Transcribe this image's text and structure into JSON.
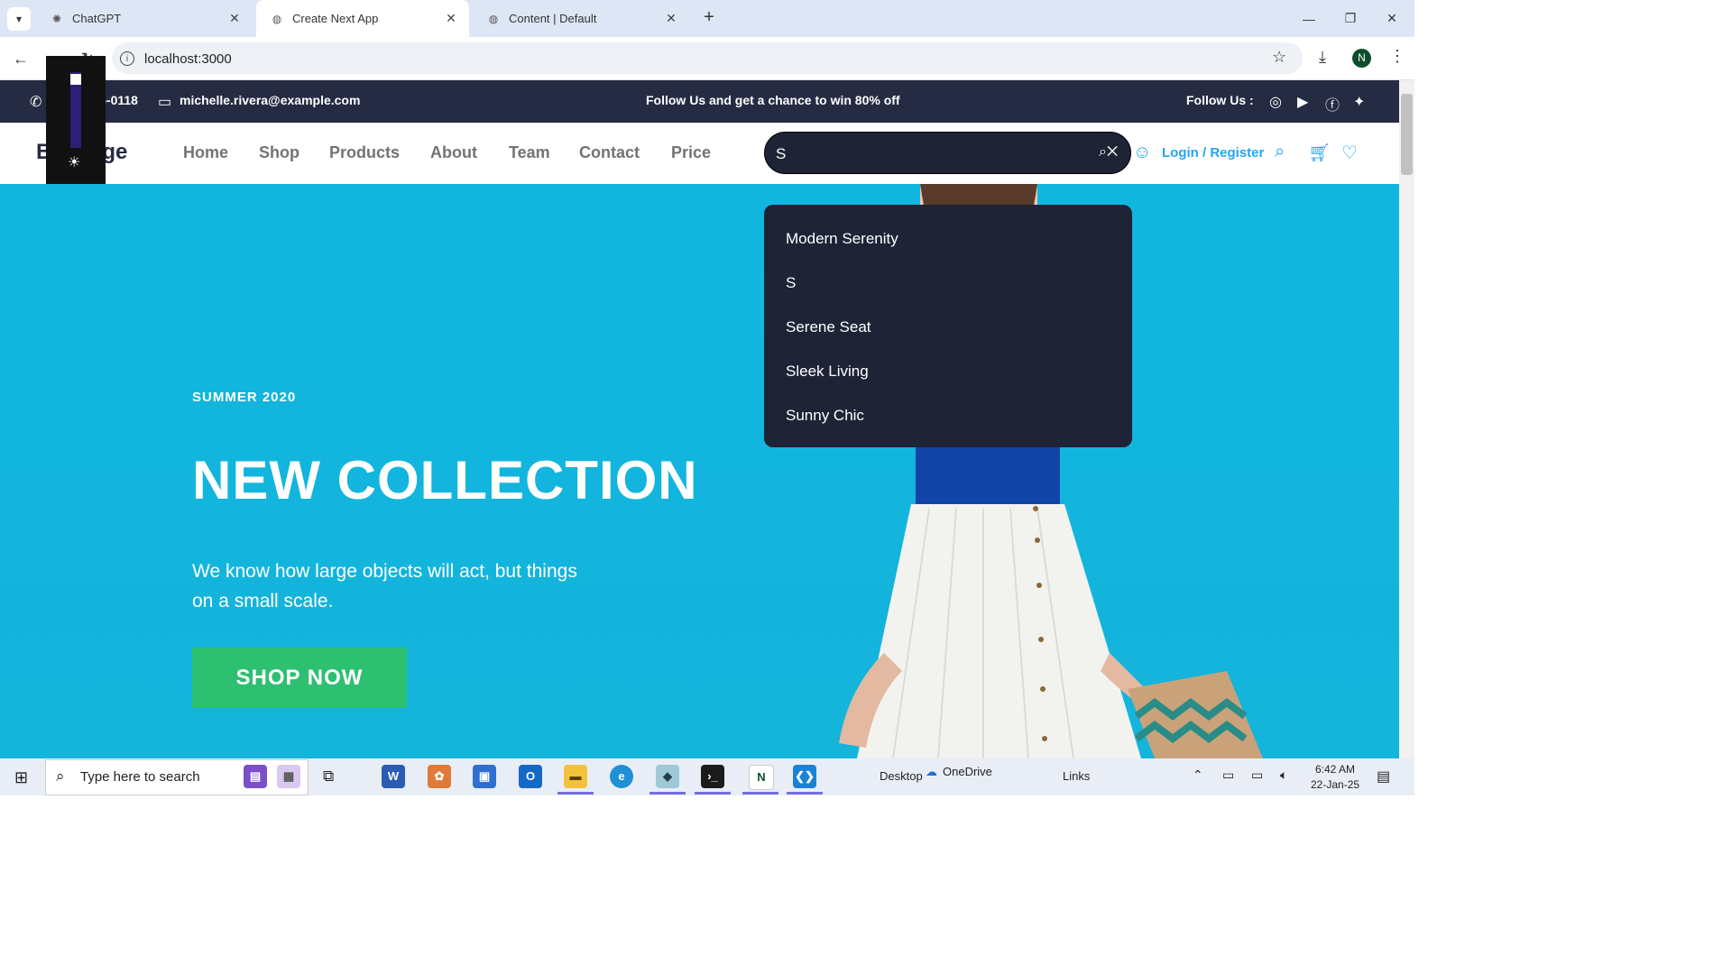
{
  "browser": {
    "tabs": [
      {
        "label": "ChatGPT",
        "icon": "openai-icon",
        "active": false
      },
      {
        "label": "Create Next App",
        "icon": "globe-icon",
        "active": true
      },
      {
        "label": "Content | Default",
        "icon": "globe-icon",
        "active": false
      }
    ],
    "url": "localhost:3000",
    "profile_initial": "N"
  },
  "topbar": {
    "phone": "(225) 555-0118",
    "email": "michelle.rivera@example.com",
    "promo": "Follow Us  and get a chance to win 80% off",
    "follow_label": "Follow Us  :"
  },
  "header": {
    "brand": "Bandage",
    "nav": [
      "Home",
      "Shop",
      "Products",
      "About",
      "Team",
      "Contact",
      "Price"
    ],
    "search_value": "S",
    "login_label": "Login / Register"
  },
  "search_results": [
    "Modern Serenity",
    "S",
    "Serene Seat",
    "Sleek Living",
    "Sunny Chic"
  ],
  "hero": {
    "eyebrow": "SUMMER 2020",
    "title": "NEW COLLECTION",
    "subtitle": "We know how large objects will act, but things on a small scale.",
    "cta": "SHOP NOW"
  },
  "taskbar": {
    "search_placeholder": "Type here to search",
    "desktop": "Desktop",
    "onedrive": "OneDrive",
    "links": "Links",
    "time": "6:42 AM",
    "date": "22-Jan-25"
  },
  "colors": {
    "topbar_bg": "#252b42",
    "hero_bg": "#11b6df",
    "accent_blue": "#23a6f0",
    "cta_green": "#2dc071",
    "dropdown_bg": "#1e2436"
  }
}
